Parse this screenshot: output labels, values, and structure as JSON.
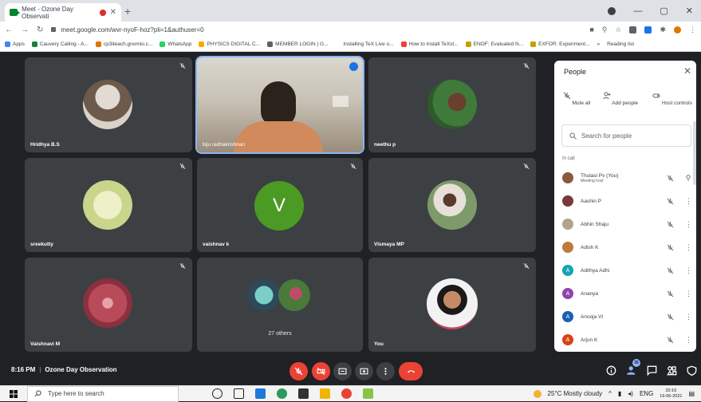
{
  "browser": {
    "tab_title": "Meet - Ozone Day Observati",
    "new_tab": "+",
    "url": "meet.google.com/wvr-nyoF-hoz?pli=1&authuser=0",
    "bookmarks": [
      {
        "label": "Apps",
        "color": "#4285f4"
      },
      {
        "label": "Cauvery Calling - A...",
        "color": "#188038"
      },
      {
        "label": "cp3iteach.gnomio.c...",
        "color": "#e37400"
      },
      {
        "label": "WhatsApp",
        "color": "#25d366"
      },
      {
        "label": "PHYSICS DIGITAL C...",
        "color": "#f9ab00"
      },
      {
        "label": "MEMBER LOGIN | G...",
        "color": "#5f6368"
      },
      {
        "label": "Installing TeX Live o...",
        "color": "#ffffff"
      },
      {
        "label": "How to install TeXst...",
        "color": "#ea4335"
      },
      {
        "label": "ENOF: Evaluated N...",
        "color": "#c5a100"
      },
      {
        "label": "EXFOR: Experiment...",
        "color": "#c5a100"
      }
    ],
    "more_bookmarks": "»",
    "reading_list": "Reading list"
  },
  "tiles": [
    {
      "name": "Hridhya B.S",
      "avatar_color": "#6d5a4b"
    },
    {
      "name": "biju radhakrishnan",
      "speaking": true
    },
    {
      "name": "neethu p",
      "avatar_color": "#3f7a3a"
    },
    {
      "name": "sreekutty",
      "avatar_color": "#c9d58a"
    },
    {
      "name": "vaishnav k",
      "initial": "V",
      "avatar_color": "#4b9a23"
    },
    {
      "name": "Vismaya MP",
      "avatar_color": "#7e9a6a"
    },
    {
      "name": "Vaishnavi M",
      "avatar_color": "#b84a5a"
    },
    {
      "others": "27 others"
    },
    {
      "name": "You",
      "avatar_color": "#8a5a3a"
    }
  ],
  "bottom": {
    "time": "8:16 PM",
    "meeting_title": "Ozone Day Observation",
    "participant_count": "35"
  },
  "people_panel": {
    "title": "People",
    "actions": [
      {
        "label": "Mute all"
      },
      {
        "label": "Add people"
      },
      {
        "label": "Host controls"
      }
    ],
    "search_placeholder": "Search for people",
    "section": "In call",
    "participants": [
      {
        "name": "Thulasi Pv (You)",
        "sub": "Meeting host",
        "avatar_color": "#8a5a3a",
        "initial": ""
      },
      {
        "name": "Aashin P",
        "sub": "",
        "avatar_color": "#7a3a3a",
        "initial": ""
      },
      {
        "name": "Abhin Shaju",
        "sub": "",
        "avatar_color": "#b0a48a",
        "initial": ""
      },
      {
        "name": "Adish K",
        "sub": "",
        "avatar_color": "#c07a3a",
        "initial": ""
      },
      {
        "name": "Adithya Adhi",
        "sub": "",
        "avatar_color": "#12a4af",
        "initial": "A"
      },
      {
        "name": "Ananya",
        "sub": "",
        "avatar_color": "#8e44ad",
        "initial": "A"
      },
      {
        "name": "Anooja Vt",
        "sub": "",
        "avatar_color": "#1a5fb4",
        "initial": "A"
      },
      {
        "name": "Arjun K",
        "sub": "",
        "avatar_color": "#d84315",
        "initial": "A"
      }
    ]
  },
  "taskbar": {
    "search_placeholder": "Type here to search",
    "weather": "25°C  Mostly cloudy",
    "language": "ENG",
    "time": "20:16",
    "date": "16-06-2021"
  }
}
